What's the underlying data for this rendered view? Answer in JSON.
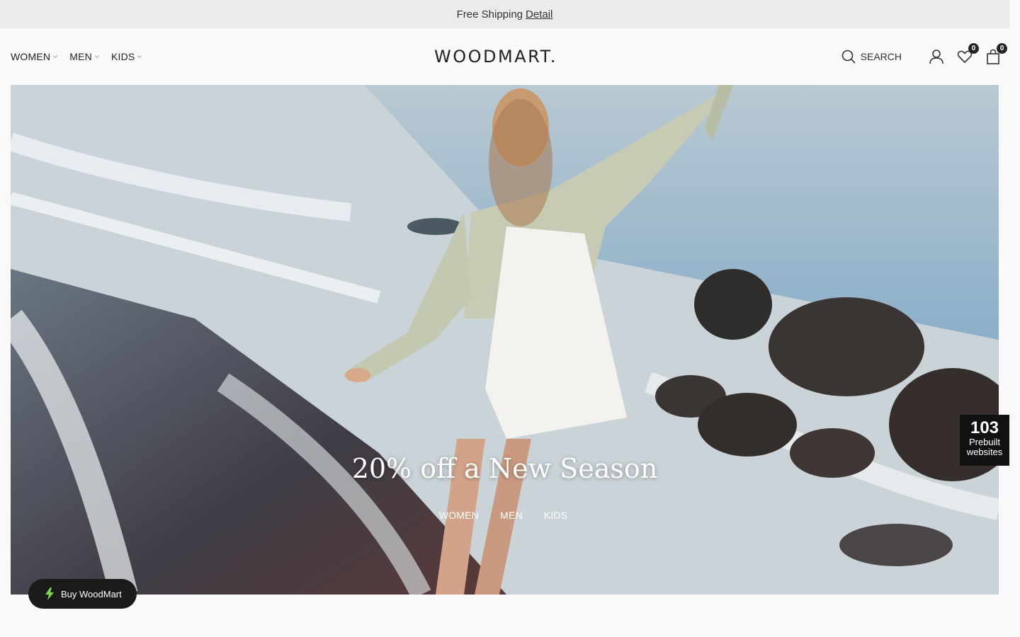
{
  "topbar": {
    "text": "Free Shipping",
    "link": "Detail"
  },
  "nav": {
    "items": [
      {
        "label": "WOMEN"
      },
      {
        "label": "MEN"
      },
      {
        "label": "KIDS"
      }
    ]
  },
  "logo": "WOODMART.",
  "header_tools": {
    "search_label": "SEARCH",
    "wishlist_count": "0",
    "cart_count": "0"
  },
  "hero": {
    "title": "20% off a New Season",
    "links": [
      "WOMEN",
      "MEN",
      "KIDS"
    ]
  },
  "badge": {
    "number": "103",
    "line1": "Prebuilt",
    "line2": "websites"
  },
  "buy_button": {
    "label": "Buy WoodMart",
    "icon": "bolt-icon"
  },
  "icons": {
    "search": "search-icon",
    "account": "user-icon",
    "wishlist": "heart-icon",
    "cart": "bag-icon",
    "chevron": "chevron-down-icon"
  }
}
